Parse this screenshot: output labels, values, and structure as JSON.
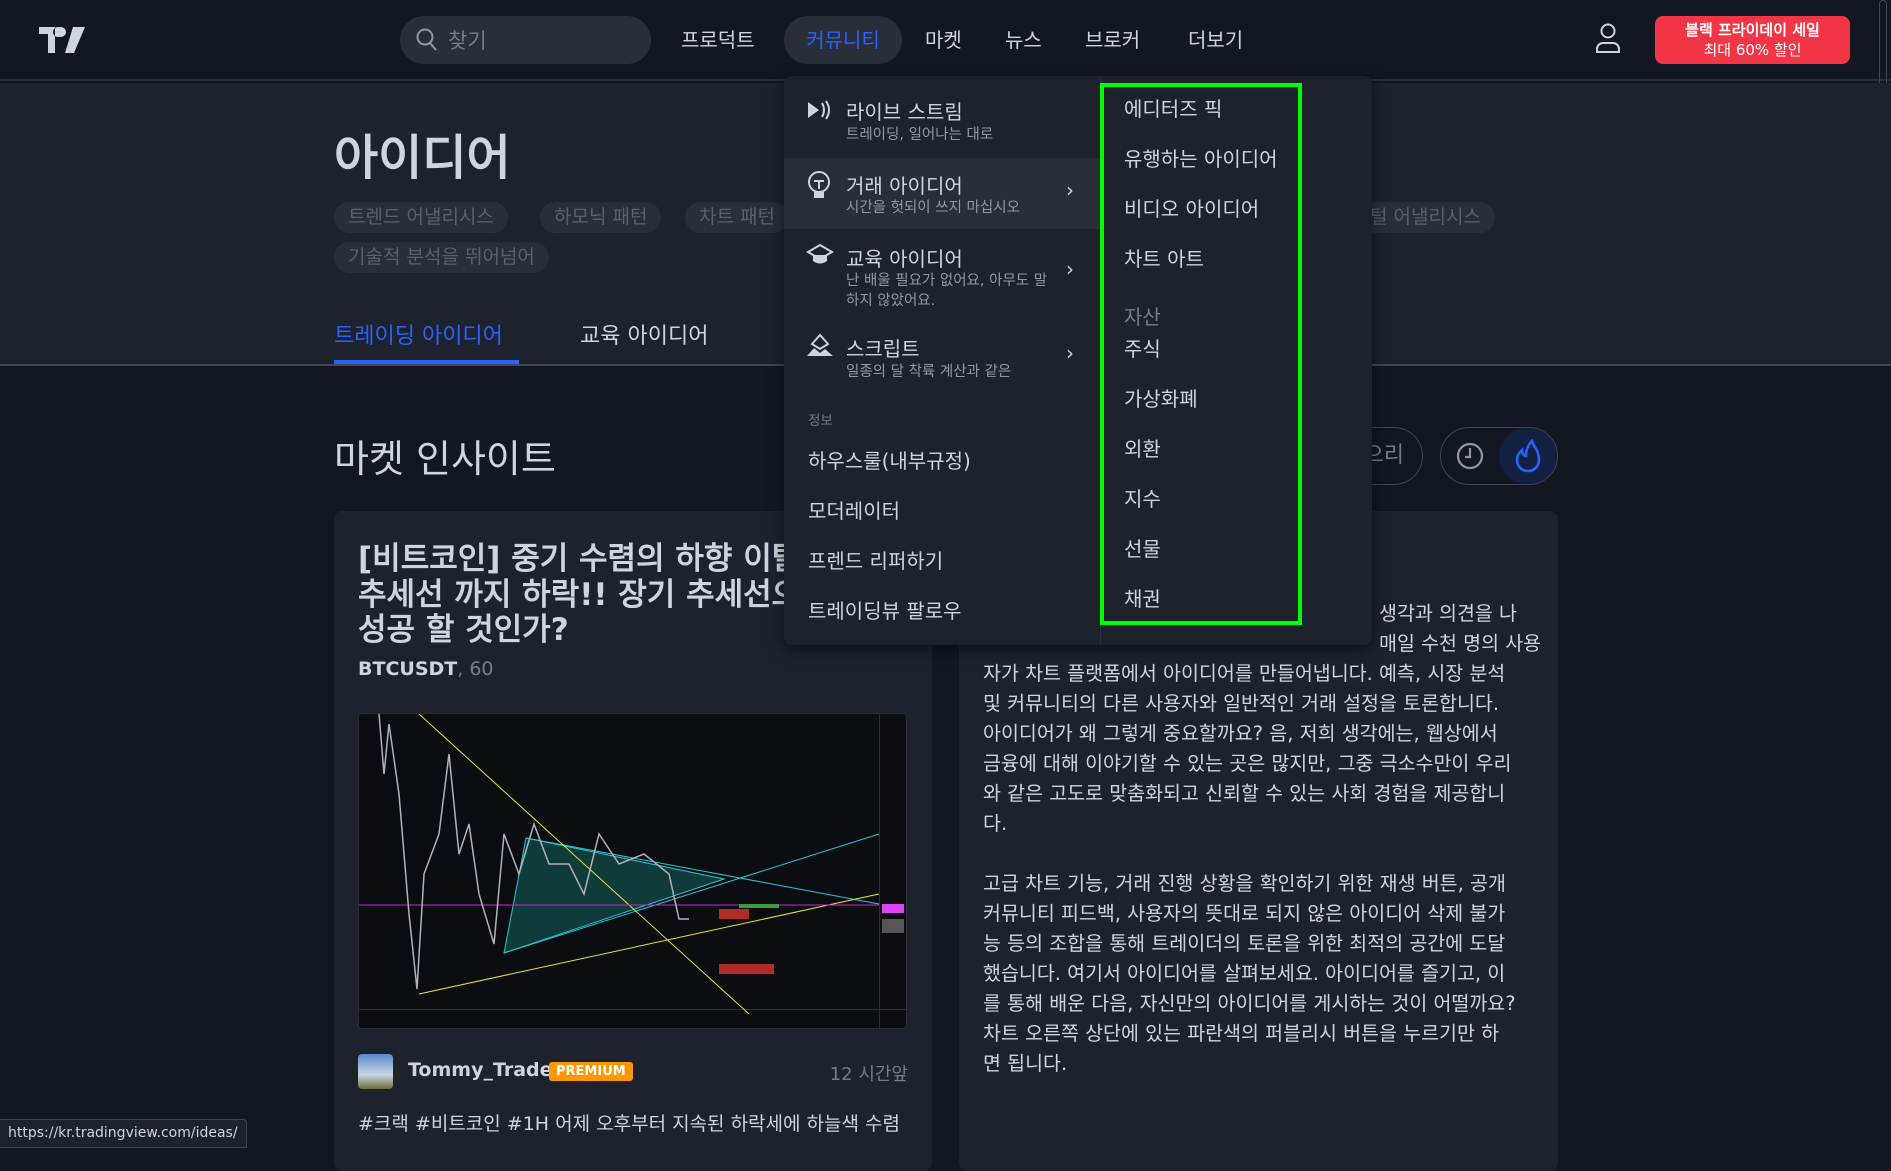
{
  "header": {
    "search_placeholder": "찾기",
    "nav": [
      "프로덕트",
      "커뮤니티",
      "마켓",
      "뉴스",
      "브로커",
      "더보기"
    ],
    "promo_line1": "블랙 프라이데이 세일",
    "promo_line2": "최대 60% 할인"
  },
  "hero": {
    "title": "아이디어",
    "tags": [
      "트렌드 어낼리시스",
      "하모닉 패턴",
      "차트 패턴",
      "털 어낼리시스",
      "기술적 분석을 뛰어넘어"
    ],
    "tabs": [
      "트레이딩 아이디어",
      "교육 아이디어"
    ]
  },
  "section": {
    "title": "마켓 인사이트",
    "sort_label": "으리"
  },
  "idea": {
    "title_lines": [
      "[비트코인] 중기 수렴의 하향 이탈",
      "추세선 까지 하락!! 장기 추세선으",
      "성공 할 것인가?"
    ],
    "symbol": "BTCUSDT",
    "interval": ", 60",
    "author": "Tommy_Trader",
    "badge": "PREMIUM",
    "time": "12 시간앞",
    "description": "#크랙 #비트코인 #1H 어제 오후부터 지속된 하락세에 하늘색 수렴"
  },
  "about": {
    "lines": [
      "생각과 의견을 나",
      "매일 수천 명의 사용",
      "자가 차트 플랫폼에서 아이디어를 만들어냅니다. 예측, 시장 분석",
      "및 커뮤니티의 다른 사용자와 일반적인 거래 설정을 토론합니다.",
      "아이디어가 왜 그렇게 중요할까요? 음, 저희 생각에는, 웹상에서",
      "금융에 대해 이야기할 수 있는 곳은 많지만, 그중 극소수만이 우리",
      "와 같은 고도로 맞춤화되고 신뢰할 수 있는 사회 경험을 제공합니",
      "다.",
      "",
      "고급 차트 기능, 거래 진행 상황을 확인하기 위한 재생 버튼, 공개",
      "커뮤니티 피드백, 사용자의 뜻대로 되지 않은 아이디어 삭제 불가",
      "능 등의 조합을 통해 트레이더의 토론을 위한 최적의 공간에 도달",
      "했습니다. 여기서 아이디어를 살펴보세요. 아이디어를 즐기고, 이",
      "를 통해 배운 다음, 자신만의 아이디어를 게시하는 것이 어떨까요?",
      "차트 오른쪽 상단에 있는 파란색의 퍼블리시 버튼을 누르기만 하",
      "면 됩니다."
    ]
  },
  "menu": {
    "items": [
      {
        "title": "라이브 스트림",
        "sub": "트레이딩, 일어나는 대로",
        "icon": "live-stream-icon"
      },
      {
        "title": "거래 아이디어",
        "sub": "시간을 헛되이 쓰지 마십시오",
        "icon": "lightbulb-icon"
      },
      {
        "title": "교육 아이디어",
        "sub": "난 배울 필요가 없어요, 아무도 말하지 않았어요.",
        "icon": "graduation-cap-icon"
      },
      {
        "title": "스크립트",
        "sub": "일종의 달 착륙 계산과 같은",
        "icon": "script-icon"
      }
    ],
    "info_heading": "정보",
    "info_items": [
      "하우스룰(내부규정)",
      "모더레이터",
      "프렌드 리퍼하기",
      "트레이딩뷰 팔로우"
    ],
    "sub_items": [
      "에디터즈 픽",
      "유행하는 아이디어",
      "비디오 아이디어",
      "차트 아트"
    ],
    "asset_heading": "자산",
    "asset_items": [
      "주식",
      "가상화폐",
      "외환",
      "지수",
      "선물",
      "채권"
    ]
  },
  "statusbar": {
    "url": "https://kr.tradingview.com/ideas/"
  },
  "colors": {
    "accent": "#2962ff",
    "promo": "#f23645",
    "premium": "#ff9800",
    "highlight": "#00ff00"
  }
}
